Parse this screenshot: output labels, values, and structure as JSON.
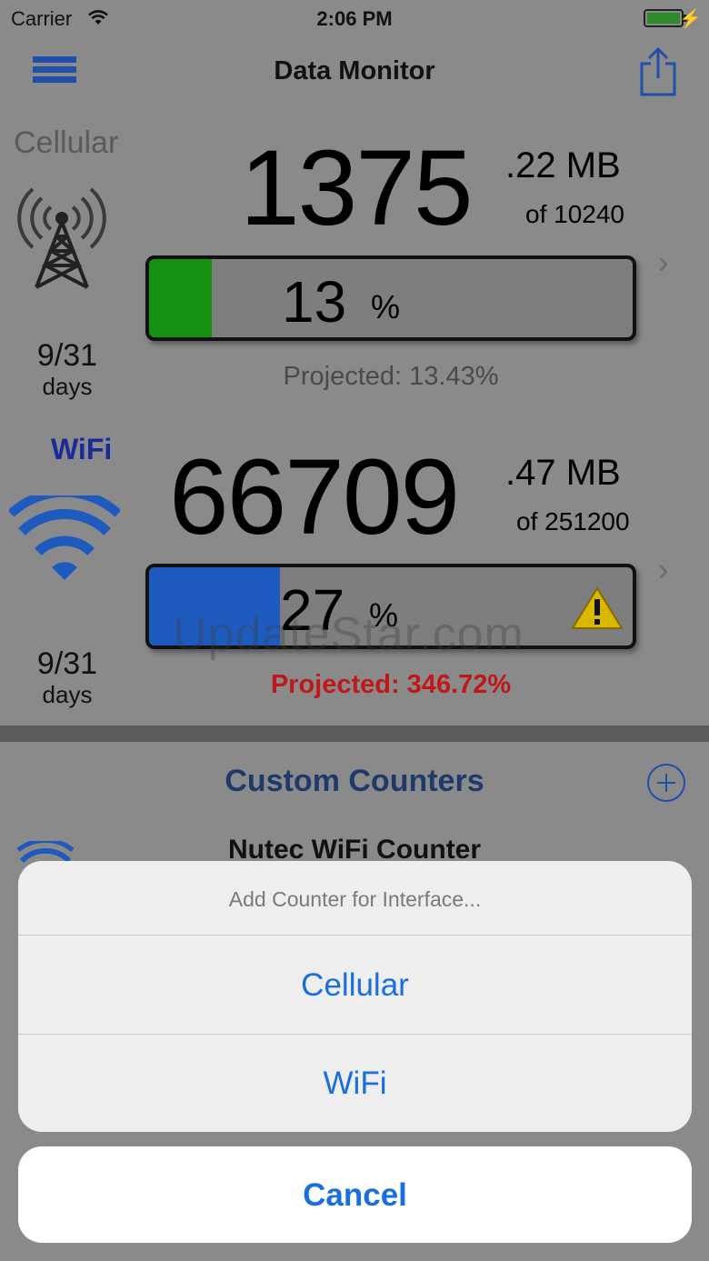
{
  "status_bar": {
    "carrier": "Carrier",
    "time": "2:06 PM",
    "battery_color": "#2e8a2a"
  },
  "nav": {
    "title": "Data Monitor",
    "menu_icon": "hamburger-icon",
    "share_icon": "share-icon"
  },
  "cellular": {
    "label": "Cellular",
    "icon": "cell-tower-icon",
    "days": "9/31",
    "days_label": "days",
    "used_whole": "1375",
    "used_decimal": ".22 MB",
    "limit": "of 10240",
    "percent": "13",
    "percent_symbol": "%",
    "percent_value": 13,
    "bar_color": "#159010",
    "projected": "Projected: 13.43%",
    "projected_color": "#4a4a4a"
  },
  "wifi": {
    "label": "WiFi",
    "icon": "wifi-icon",
    "days": "9/31",
    "days_label": "days",
    "used_whole": "66709",
    "used_decimal": ".47 MB",
    "limit": "of 251200",
    "percent": "27",
    "percent_symbol": "%",
    "percent_value": 27,
    "bar_color": "#1f5bbf",
    "warning_icon": "warning-icon",
    "projected": "Projected: 346.72%",
    "projected_color": "#c01818"
  },
  "custom_counters": {
    "title": "Custom Counters",
    "add_icon": "add-circle-icon",
    "items": [
      {
        "name": "Nutec WiFi Counter",
        "icon": "wifi-icon"
      }
    ]
  },
  "watermark": "UpdateStar.com",
  "action_sheet": {
    "title": "Add Counter for Interface...",
    "options": [
      "Cellular",
      "WiFi"
    ],
    "cancel": "Cancel",
    "accent_color": "#1a6fe0"
  }
}
